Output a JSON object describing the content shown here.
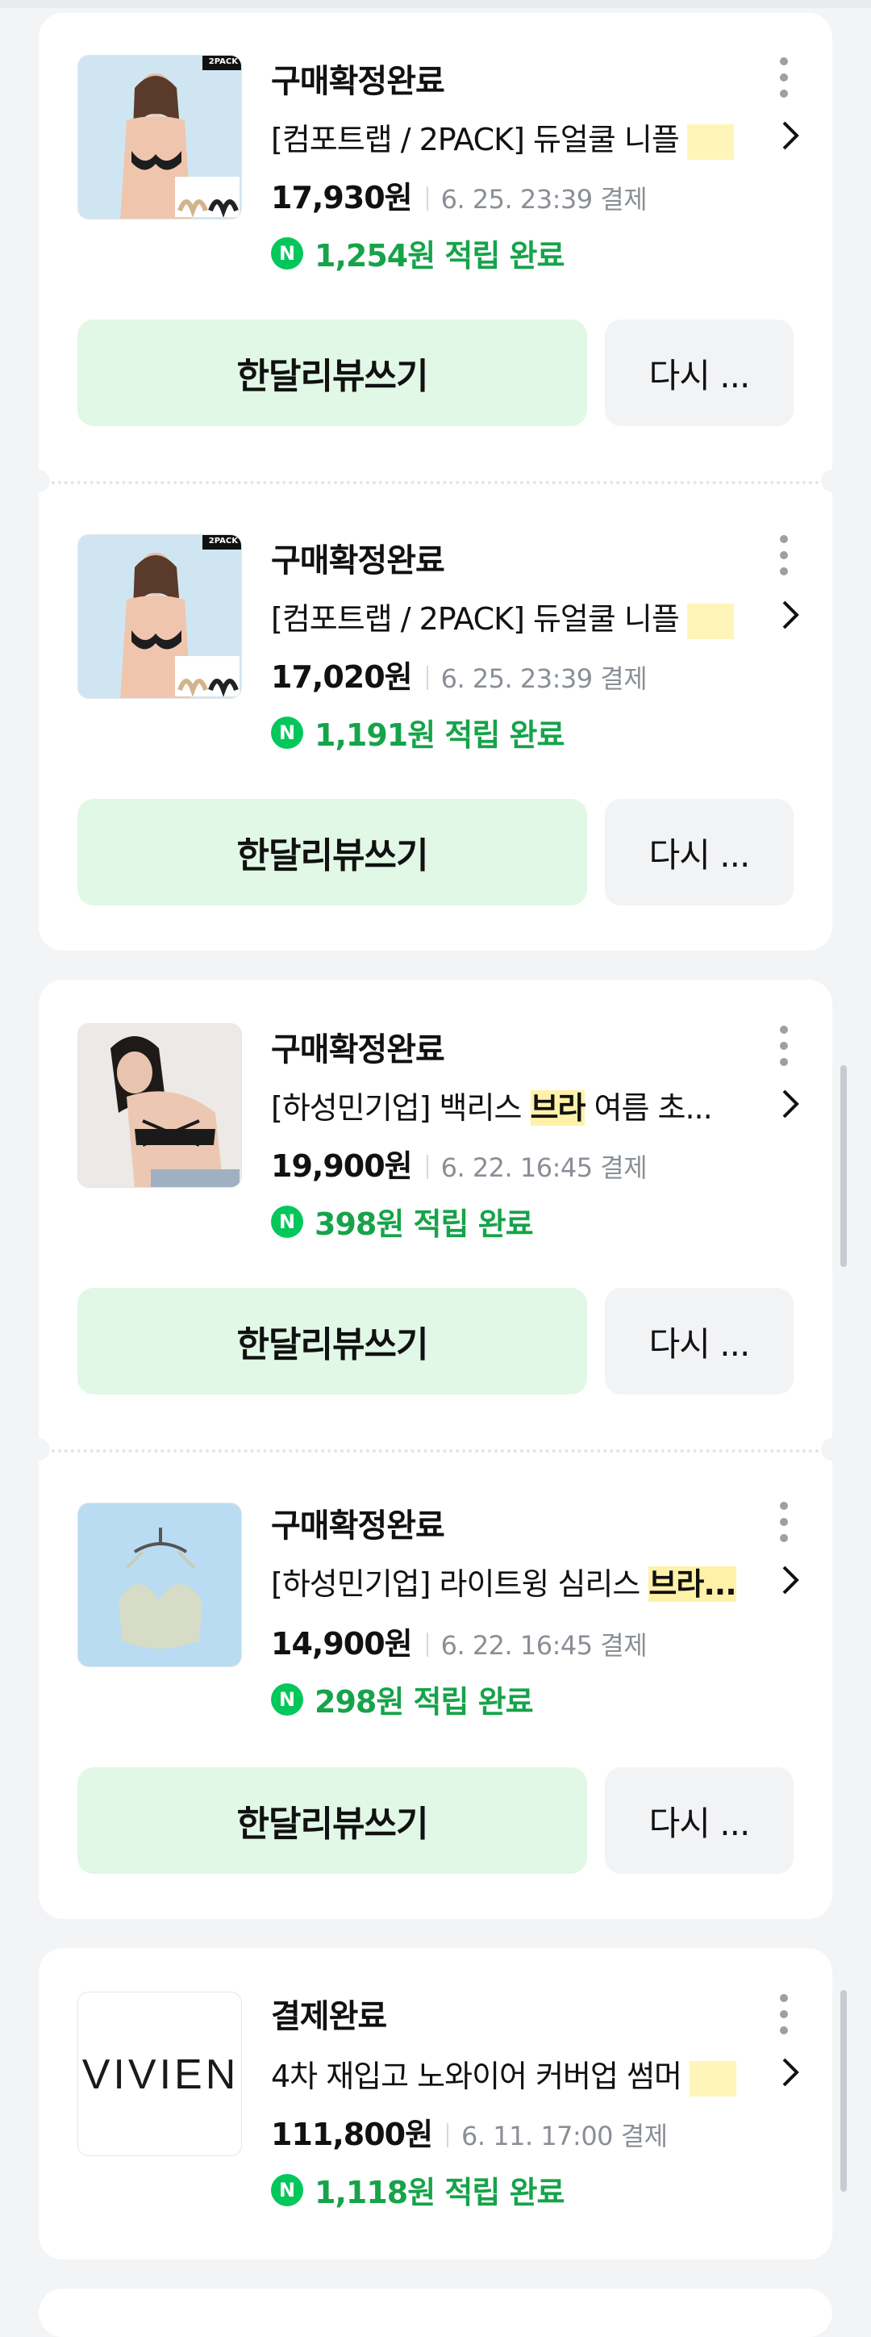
{
  "orders": [
    {
      "status": "구매확정완료",
      "title": "[컴포트랩 / 2PACK] 듀얼쿨 니플",
      "price": "17,930원",
      "date": "6. 25. 23:39 결제",
      "reward": "1,254원 적립 완료",
      "thumb_badge": "2PACK",
      "review_label": "한달리뷰쓰기",
      "again_label": "다시 ..."
    },
    {
      "status": "구매확정완료",
      "title": "[컴포트랩 / 2PACK] 듀얼쿨 니플",
      "price": "17,020원",
      "date": "6. 25. 23:39 결제",
      "reward": "1,191원 적립 완료",
      "thumb_badge": "2PACK",
      "review_label": "한달리뷰쓰기",
      "again_label": "다시 ..."
    },
    {
      "status": "구매확정완료",
      "title_pre": "[하성민기업] 백리스 ",
      "title_hl": "브라",
      "title_post": " 여름 초...",
      "price": "19,900원",
      "date": "6. 22. 16:45 결제",
      "reward": "398원 적립 완료",
      "review_label": "한달리뷰쓰기",
      "again_label": "다시 ..."
    },
    {
      "status": "구매확정완료",
      "title_pre": "[하성민기업] 라이트윙 심리스 ",
      "title_hl": "브라...",
      "price": "14,900원",
      "date": "6. 22. 16:45 결제",
      "reward": "298원 적립 완료",
      "review_label": "한달리뷰쓰기",
      "again_label": "다시 ..."
    },
    {
      "status": "결제완료",
      "title": "4차 재입고 노와이어 커버업 썸머",
      "price": "111,800원",
      "date": "6. 11. 17:00 결제",
      "reward": "1,118원 적립 완료",
      "brand_logo": "VIVIEN"
    }
  ],
  "icons": {
    "reward": "naver-pay-icon",
    "more": "more-vertical-icon",
    "chevron": "chevron-right-icon"
  },
  "colors": {
    "reward_green": "#16a34a",
    "review_button_bg": "#e0f8e5",
    "highlight": "#fff2a8"
  }
}
